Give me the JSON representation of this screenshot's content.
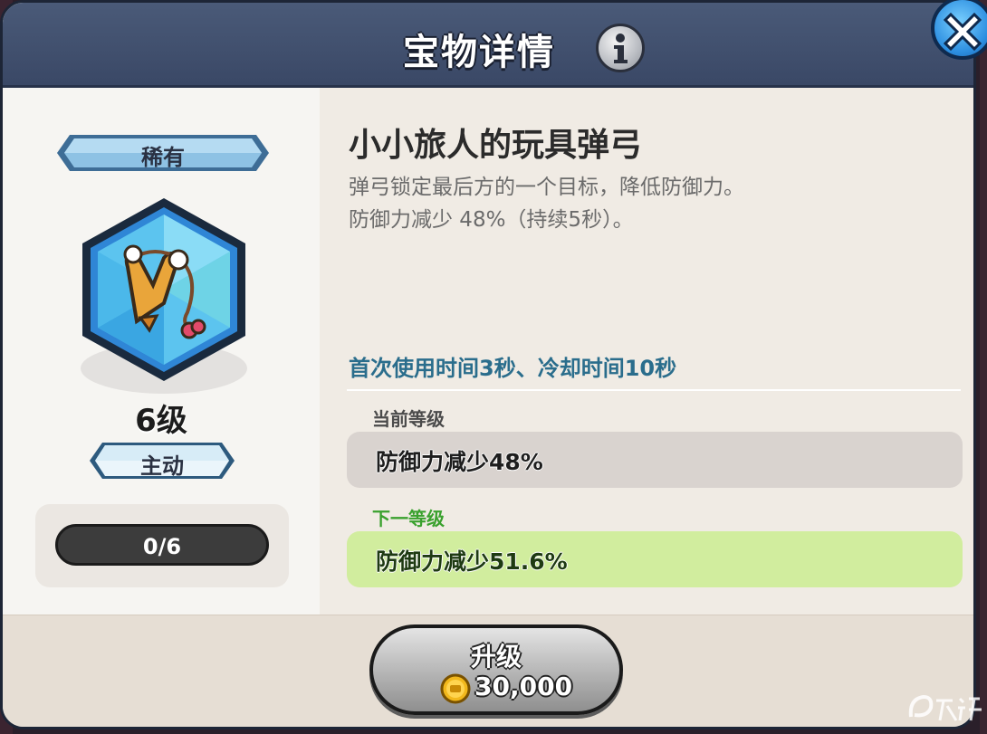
{
  "header": {
    "title": "宝物详情",
    "info_icon": "info-icon",
    "close_icon": "close-icon"
  },
  "treasure": {
    "rarity": "稀有",
    "level": "6级",
    "type": "主动",
    "icon": "slingshot-icon",
    "progress": {
      "text": "0/6",
      "current": 0,
      "max": 6
    }
  },
  "skill": {
    "name": "小小旅人的玩具弹弓",
    "description_line1": "弹弓锁定最后方的一个目标，降低防御力。",
    "description_line2": "防御力减少 48%（持续5秒）。",
    "cooldown": "首次使用时间3秒、冷却时间10秒",
    "current_level_label": "当前等级",
    "current_level_value": "防御力减少48%",
    "next_level_label": "下一等级",
    "next_level_value": "防御力减少51.6%"
  },
  "upgrade": {
    "label": "升级",
    "cost": "30,000",
    "currency_icon": "gold-coin-icon"
  },
  "watermark": {
    "icon": "9you-logo"
  },
  "colors": {
    "header": "#3f4d6c",
    "accent_blue": "#2a6d8c",
    "next_green": "#3aa12e",
    "next_box": "#d1ed9e"
  }
}
